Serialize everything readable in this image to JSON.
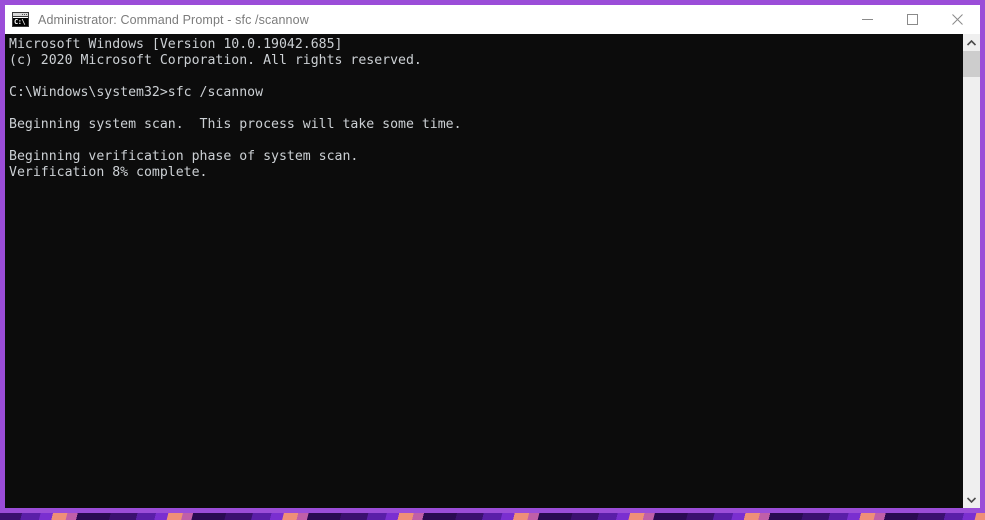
{
  "window": {
    "title": "Administrator: Command Prompt - sfc  /scannow",
    "app_icon": "cmd-icon",
    "icon_glyph": "C:\\",
    "state": "restored",
    "accent_color": "#9b4dd8",
    "titlebar_bg": "#ffffff",
    "title_color": "#7c7c7c",
    "controls": [
      {
        "name": "minimize",
        "glyph": "minimize-icon"
      },
      {
        "name": "maximize",
        "glyph": "maximize-icon"
      },
      {
        "name": "close",
        "glyph": "close-icon"
      }
    ]
  },
  "console": {
    "background_color": "#0c0c0c",
    "foreground_color": "#ccd0d4",
    "lines": [
      "Microsoft Windows [Version 10.0.19042.685]",
      "(c) 2020 Microsoft Corporation. All rights reserved.",
      "",
      "C:\\Windows\\system32>sfc /scannow",
      "",
      "Beginning system scan.  This process will take some time.",
      "",
      "Beginning verification phase of system scan.",
      "Verification 8% complete."
    ],
    "os_version": "10.0.19042.685",
    "copyright_year": "2020",
    "prompt_path": "C:\\Windows\\system32",
    "command": "sfc /scannow",
    "progress_percent": "8%",
    "status": "Verification 8% complete."
  },
  "scrollbar": {
    "up_arrow": "chevron-up-icon",
    "down_arrow": "chevron-down-icon",
    "track_color": "#efefef",
    "thumb_color": "#cdcdcd"
  },
  "desktop": {
    "wallpaper_colors": [
      "#3b1170",
      "#5a1fa8",
      "#7a2fd0",
      "#ef8f78",
      "#c05fa8",
      "#2a0b52"
    ]
  }
}
